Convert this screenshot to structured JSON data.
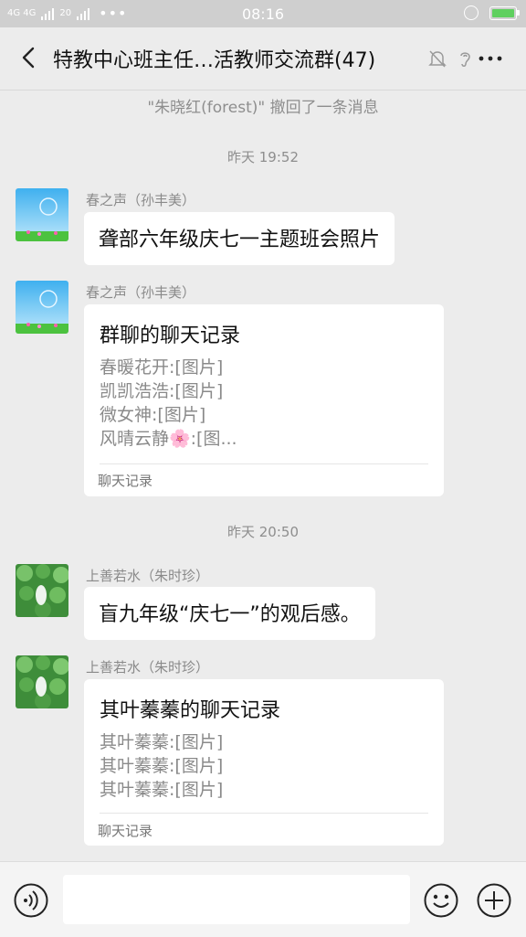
{
  "status_bar": {
    "network": "4G 4G",
    "speed": "20",
    "more": "•••",
    "time": "08:16"
  },
  "header": {
    "title": "特教中心班主任…活教师交流群(47)"
  },
  "system_notice": "\"朱晓红(forest)\" 撤回了一条消息",
  "messages": [
    {
      "time_label": "昨天 19:52",
      "items": [
        {
          "sender": "春之声（孙丰美）",
          "type": "text",
          "text": "聋部六年级庆七一主题班会照片"
        },
        {
          "sender": "春之声（孙丰美）",
          "type": "record",
          "title": "群聊的聊天记录",
          "lines": [
            "春暖花开:[图片]",
            "凯凯浩浩:[图片]",
            "微女神:[图片]",
            "风晴云静🌸:[图..."
          ],
          "footer": "聊天记录"
        }
      ]
    },
    {
      "time_label": "昨天 20:50",
      "items": [
        {
          "sender": "上善若水（朱时珍）",
          "type": "text",
          "text": "盲九年级“庆七一”的观后感。"
        },
        {
          "sender": "上善若水（朱时珍）",
          "type": "record",
          "title": "其叶蓁蓁的聊天记录",
          "lines": [
            "其叶蓁蓁:[图片]",
            "其叶蓁蓁:[图片]",
            "其叶蓁蓁:[图片]"
          ],
          "footer": "聊天记录"
        }
      ]
    }
  ],
  "input_bar": {
    "voice_icon": "voice-icon",
    "emoji_icon": "emoji-icon",
    "plus_icon": "plus-icon",
    "placeholder": ""
  },
  "colors": {
    "background": "#ececec",
    "status_bar": "#cfcfcf",
    "battery": "#5fd05f"
  }
}
